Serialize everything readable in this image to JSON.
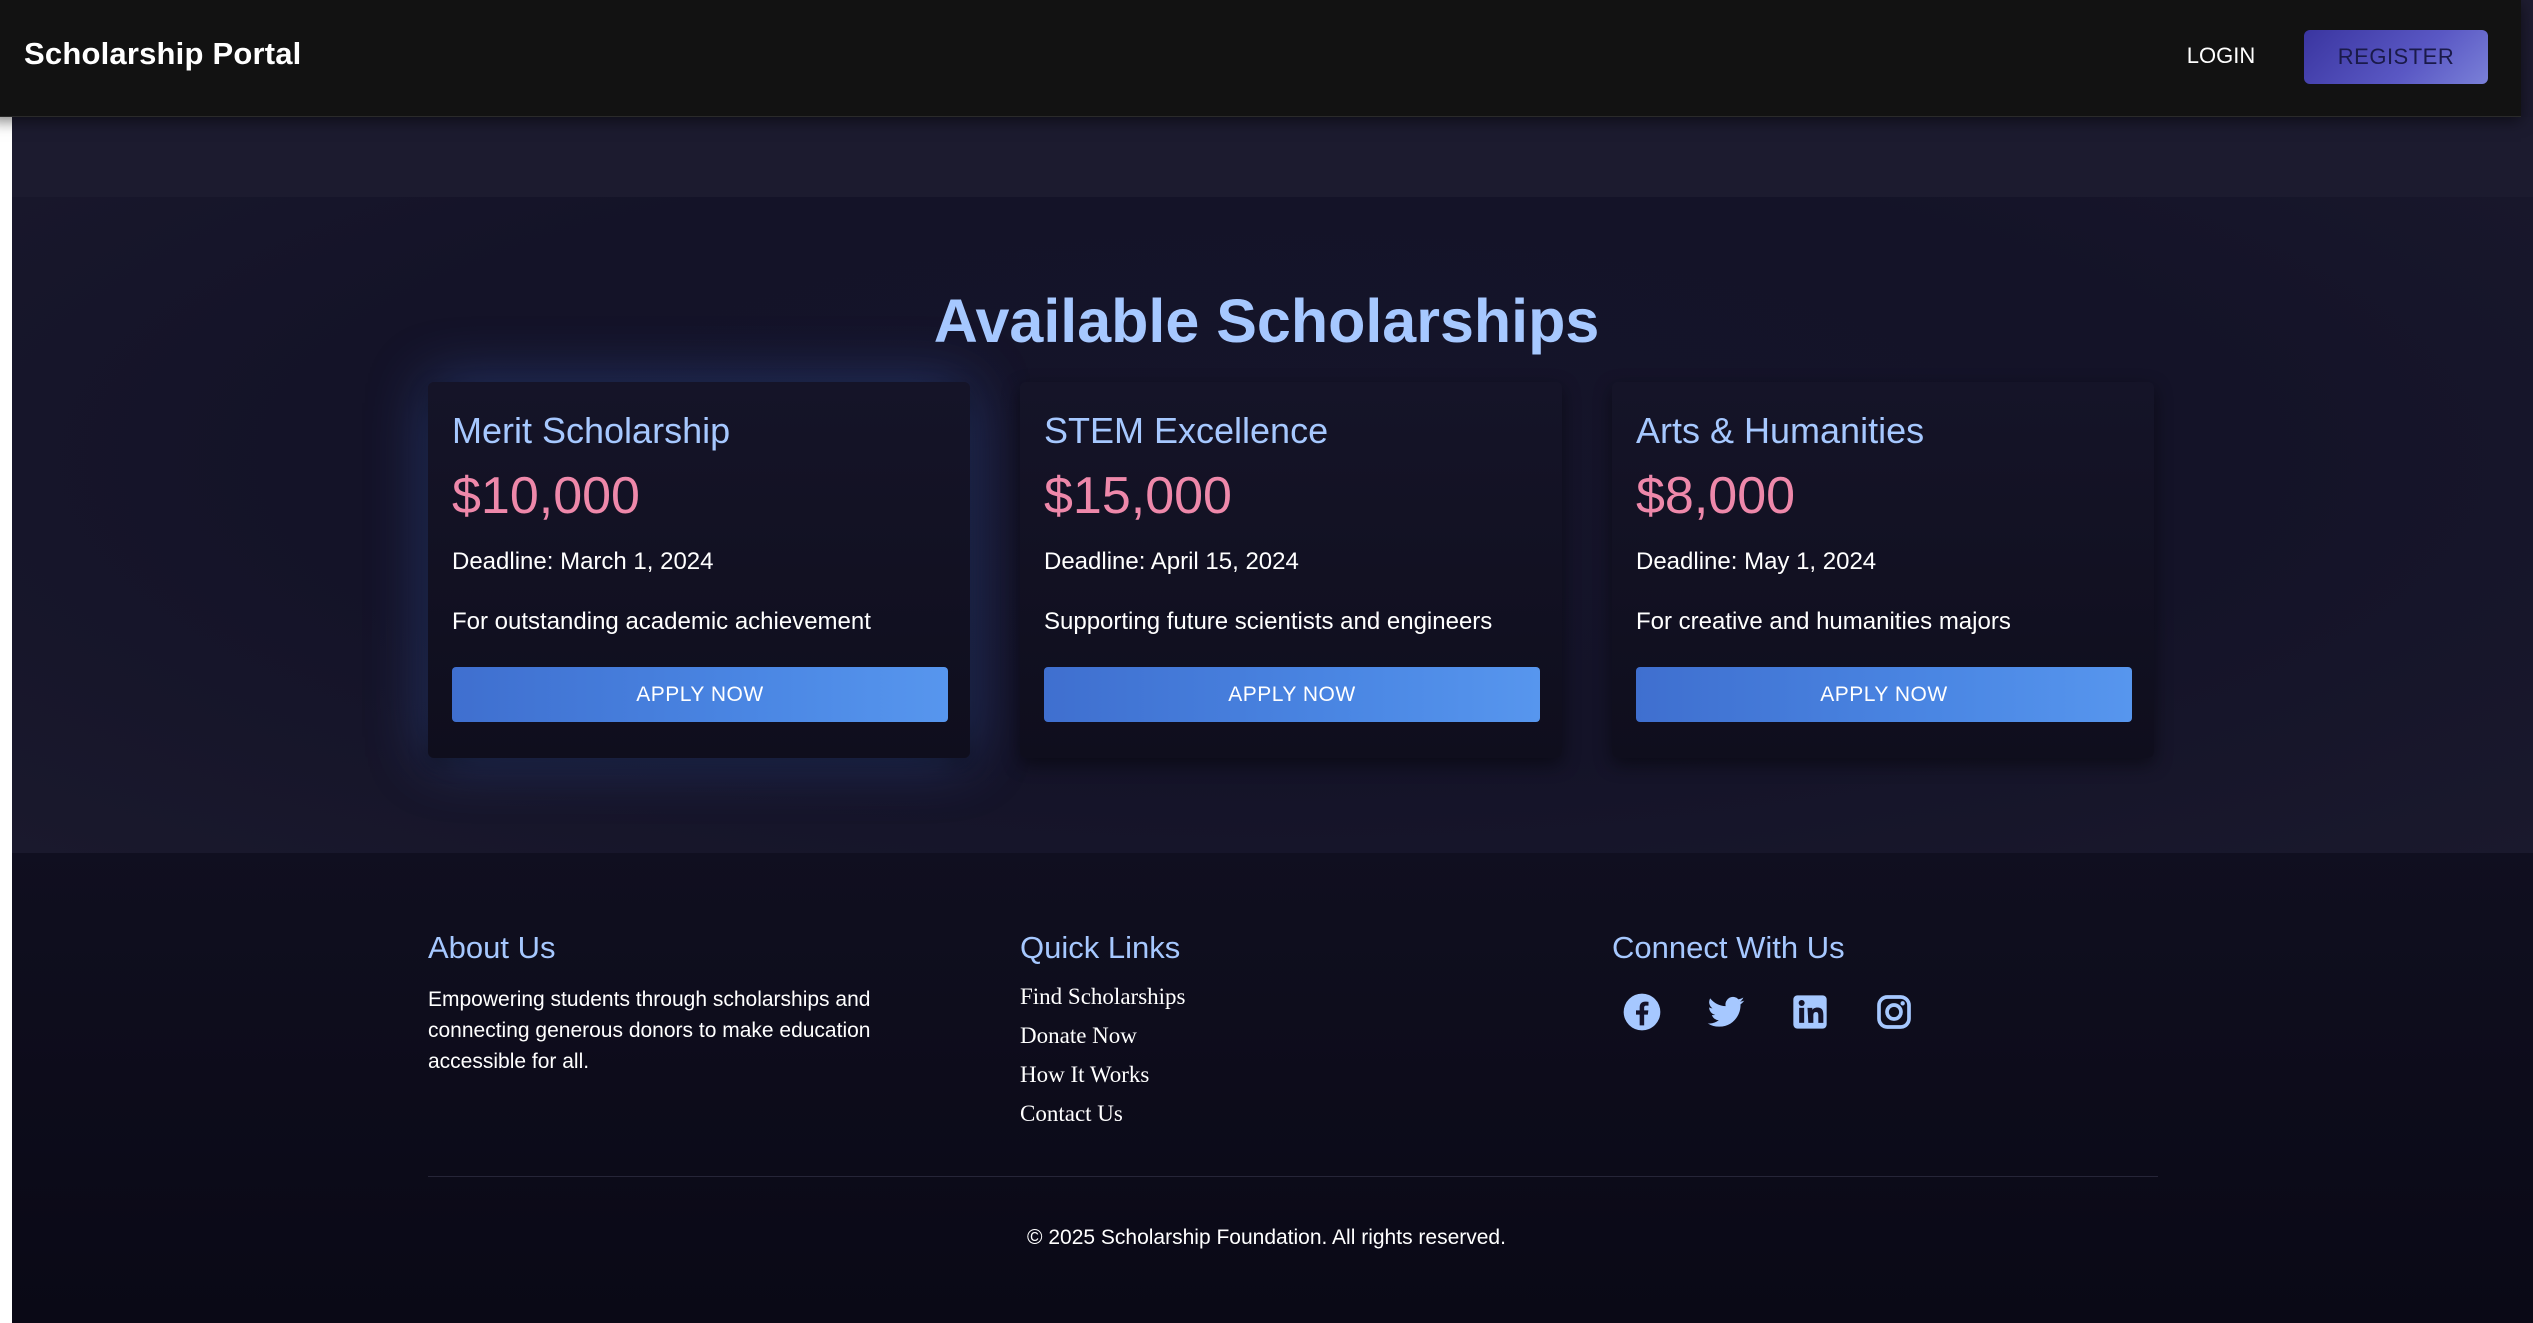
{
  "header": {
    "brand": "Scholarship Portal",
    "login_label": "LOGIN",
    "register_label": "REGISTER"
  },
  "main": {
    "title": "Available Scholarships",
    "cards": [
      {
        "title": "Merit Scholarship",
        "amount": "$10,000",
        "deadline": "Deadline: March 1, 2024",
        "description": "For outstanding academic achievement",
        "button": "APPLY NOW"
      },
      {
        "title": "STEM Excellence",
        "amount": "$15,000",
        "deadline": "Deadline: April 15, 2024",
        "description": "Supporting future scientists and engineers",
        "button": "APPLY NOW"
      },
      {
        "title": "Arts & Humanities",
        "amount": "$8,000",
        "deadline": "Deadline: May 1, 2024",
        "description": "For creative and humanities majors",
        "button": "APPLY NOW"
      }
    ]
  },
  "footer": {
    "about": {
      "title": "About Us",
      "text": "Empowering students through scholarships and connecting generous donors to make education accessible for all."
    },
    "links": {
      "title": "Quick Links",
      "items": [
        "Find Scholarships",
        "Donate Now",
        "How It Works",
        "Contact Us"
      ]
    },
    "connect": {
      "title": "Connect With Us",
      "icons": [
        "facebook-icon",
        "twitter-icon",
        "linkedin-icon",
        "instagram-icon"
      ]
    },
    "copyright": "© 2025 Scholarship Foundation. All rights reserved."
  },
  "colors": {
    "accent": "#a6c8ff",
    "amount": "#ee88aa",
    "button": "#4a86e3",
    "register": "#4a48b8",
    "navbar": "#121212"
  }
}
